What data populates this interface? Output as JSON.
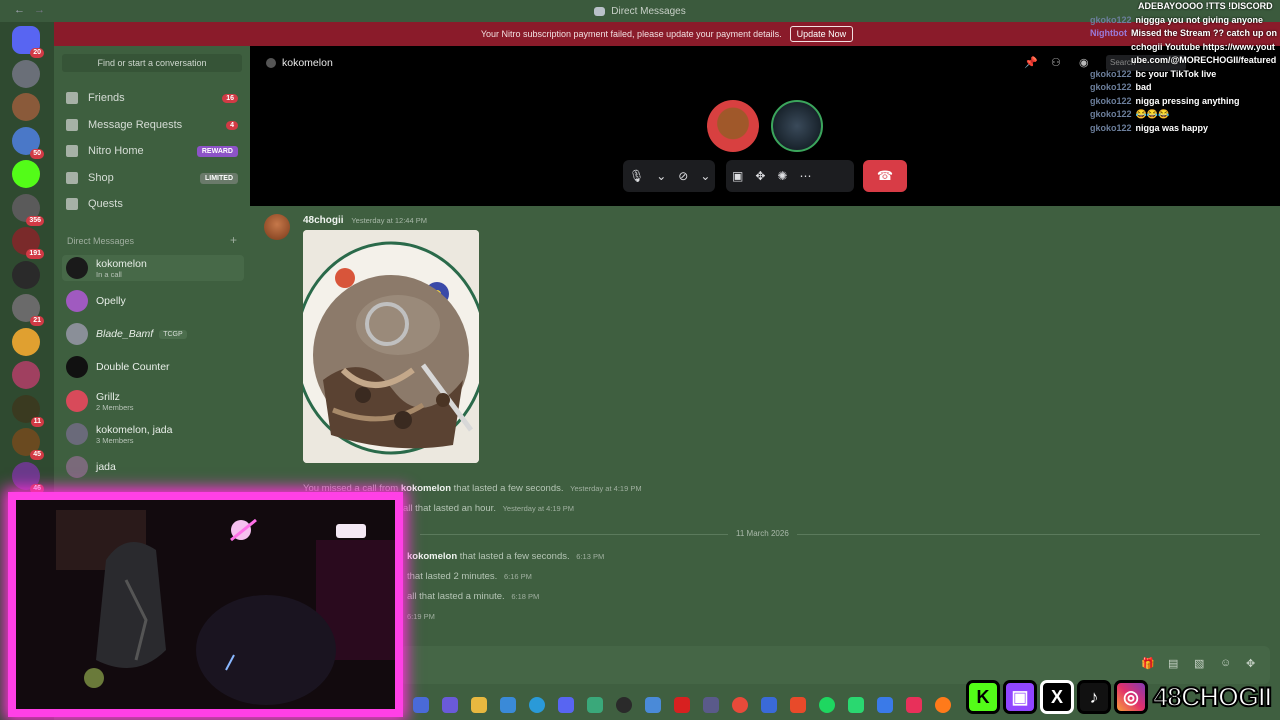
{
  "window": {
    "title": "Direct Messages"
  },
  "banner": {
    "message": "Your Nitro subscription payment failed, please update your payment details.",
    "button": "Update Now"
  },
  "servers": [
    {
      "badge": "20",
      "color": "#5865f2"
    },
    {
      "badge": "",
      "color": "#6a6f78"
    },
    {
      "badge": "",
      "color": "#8a5a3a"
    },
    {
      "badge": "50",
      "color": "#4a78c8"
    },
    {
      "badge": "",
      "color": "#53fc18"
    },
    {
      "badge": "356",
      "color": "#5a5a5a"
    },
    {
      "badge": "191",
      "color": "#7a2a2a"
    },
    {
      "badge": "",
      "color": "#2a2a2a"
    },
    {
      "badge": "21",
      "color": "#6a6a6a"
    },
    {
      "badge": "",
      "color": "#e0a030"
    },
    {
      "badge": "",
      "color": "#a04060"
    },
    {
      "badge": "11",
      "color": "#3a3a20"
    },
    {
      "badge": "45",
      "color": "#6a4a20"
    },
    {
      "badge": "46",
      "color": "#6a3a8a"
    }
  ],
  "sidebar": {
    "find_placeholder": "Find or start a conversation",
    "nav": [
      {
        "label": "Friends",
        "badge": "16",
        "icon": "friends-icon"
      },
      {
        "label": "Message Requests",
        "badge": "4",
        "icon": "envelope-icon"
      },
      {
        "label": "Nitro Home",
        "tag": "REWARD",
        "icon": "nitro-icon"
      },
      {
        "label": "Shop",
        "tag": "LIMITED",
        "icon": "shop-icon"
      },
      {
        "label": "Quests",
        "icon": "quests-icon"
      }
    ],
    "dm_header": "Direct Messages",
    "dms": [
      {
        "name": "kokomelon",
        "sub": "In a call",
        "tag": ""
      },
      {
        "name": "Opelly",
        "sub": "",
        "tag": ""
      },
      {
        "name": "Blade_Bamf",
        "sub": "",
        "tag": "TCGP"
      },
      {
        "name": "Double Counter",
        "sub": "",
        "tag": ""
      },
      {
        "name": "Grillz",
        "sub": "2 Members",
        "tag": ""
      },
      {
        "name": "kokomelon, jada",
        "sub": "3 Members",
        "tag": ""
      },
      {
        "name": "jada",
        "sub": "",
        "tag": ""
      }
    ]
  },
  "call": {
    "name": "kokomelon",
    "search_placeholder": "Search"
  },
  "messages": {
    "author": "48chogii",
    "timestamp": "Yesterday at 12:44 PM",
    "missed_prefix": "You missed a call from",
    "missed_user": "kokomelon",
    "missed_suffix": "that lasted a few seconds.",
    "missed_ts": "Yesterday at 4:19 PM",
    "line2": "all that lasted an hour.",
    "line2_ts": "Yesterday at 4:19 PM",
    "date_divider": "11 March 2026",
    "line3_user": "kokomelon",
    "line3_suffix": "that lasted a few seconds.",
    "line3_ts": "6:13 PM",
    "line4": "that lasted 2 minutes.",
    "line4_ts": "6:16 PM",
    "line5": "all that lasted a minute.",
    "line5_ts": "6:18 PM",
    "line6_ts": "6:19 PM"
  },
  "chat": [
    {
      "user": "",
      "text": "ADEBAYOOOO !TTS !DISCORD"
    },
    {
      "user": "gkoko122",
      "text": "niggga you not giving anyone"
    },
    {
      "user": "Nightbot",
      "text": "Missed the Stream ?? catch up on cchogii Youtube https://www.youtube.com/@MORECHOGII/featured"
    },
    {
      "user": "gkoko122",
      "text": "bc your TikTok live"
    },
    {
      "user": "gkoko122",
      "text": "bad"
    },
    {
      "user": "gkoko122",
      "text": "nigga pressing anything"
    },
    {
      "user": "gkoko122",
      "text": "😂😂😂"
    },
    {
      "user": "gkoko122",
      "text": "nigga was happy"
    }
  ],
  "socials": {
    "handle": "48CHOGII",
    "kick": "K",
    "x": "X"
  }
}
